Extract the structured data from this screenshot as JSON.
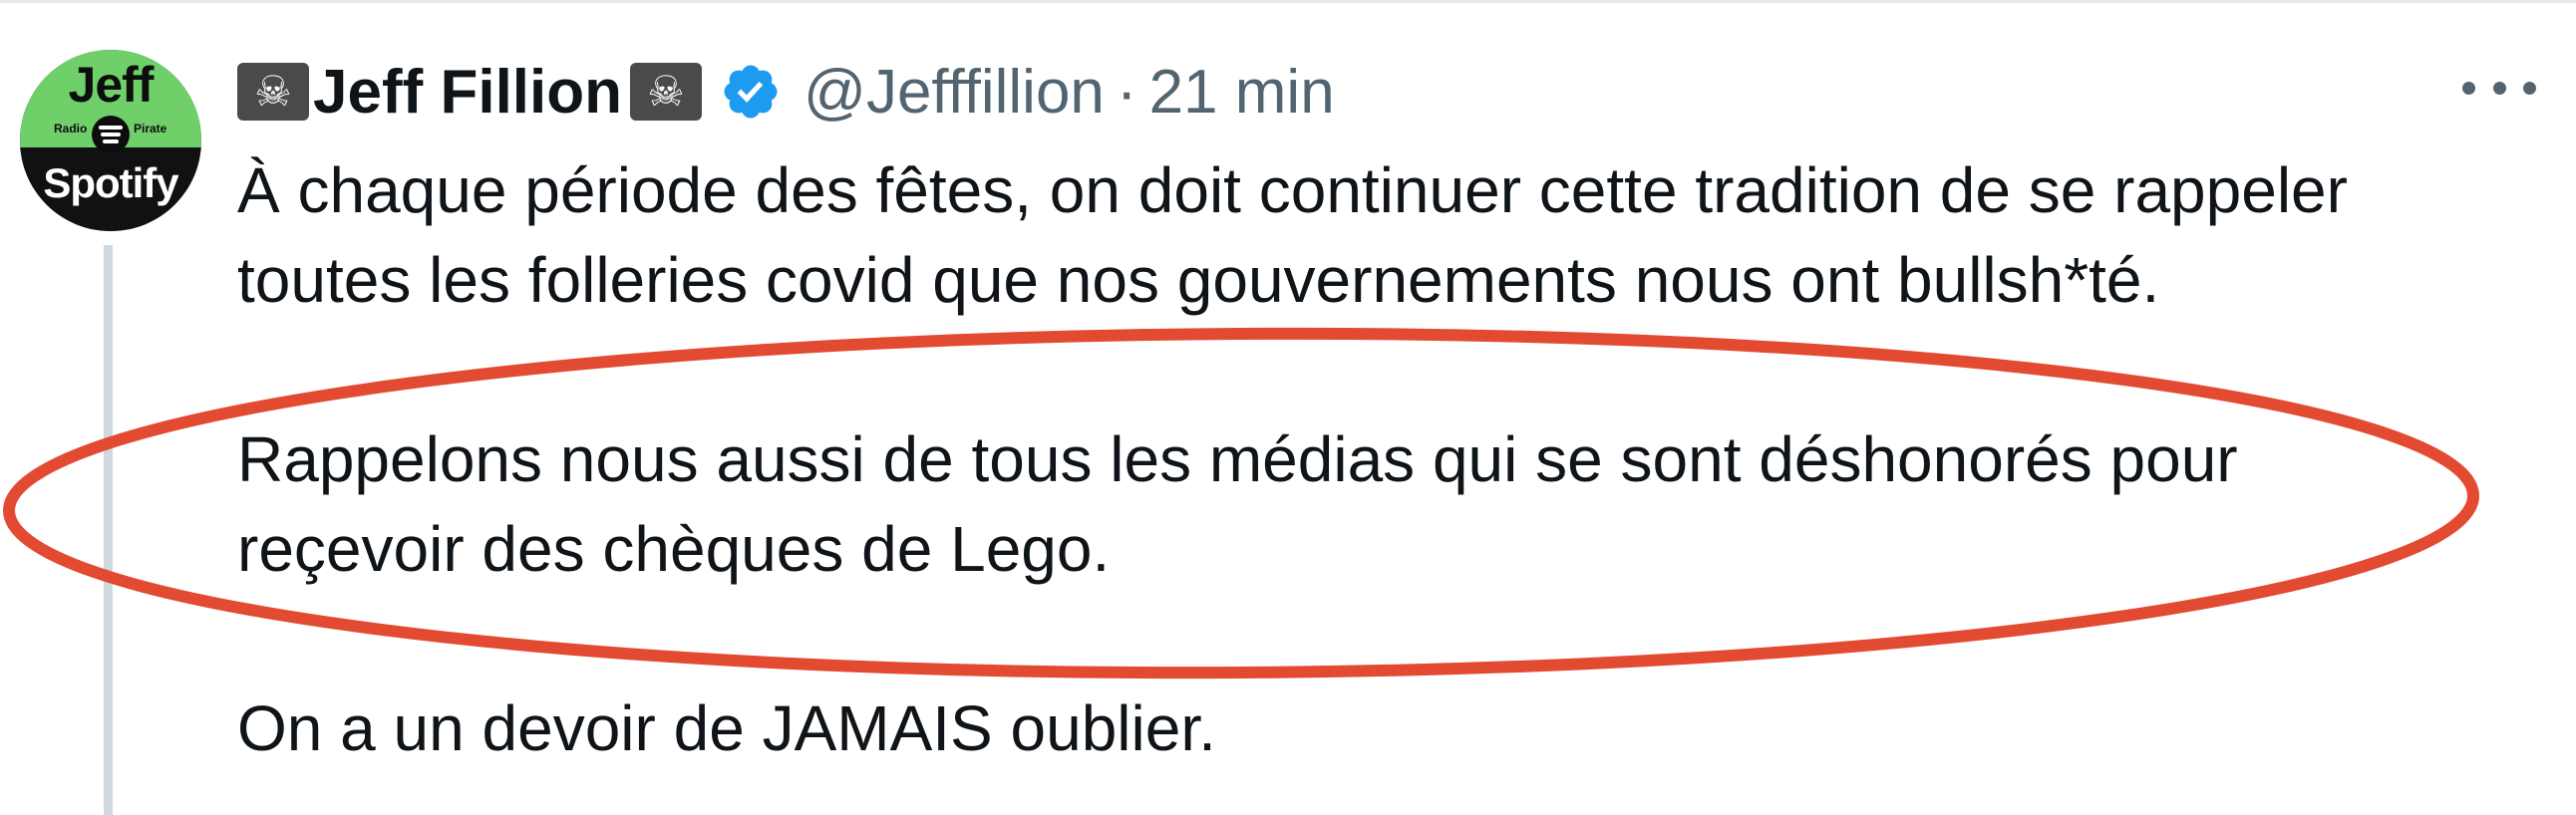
{
  "tweet": {
    "author": {
      "display_name": "Jeff Fillion",
      "handle": "@Jefffillion",
      "verified": true,
      "name_emoji": "☠"
    },
    "separator": "·",
    "time": "21 min",
    "avatar": {
      "top_text": "Jeff",
      "small_left": "Radio",
      "small_right": "Pirate",
      "bottom_text": "Spotify"
    },
    "text_lines": [
      "À chaque période des fêtes, on doit continuer cette tradition de se rappeler",
      "toutes les folleries covid que nos gouvernements nous ont bullsh*té.",
      "Rappelons nous aussi de tous les médias qui se sont déshonorés pour",
      "reçevoir des chèques de Lego.",
      "On a un devoir de JAMAIS oublier."
    ]
  },
  "colors": {
    "text": "#0f1419",
    "secondary_text": "#536471",
    "verified_badge": "#1d9bf0",
    "annotation_ellipse": "#e34a32",
    "thread_line": "#cfd9de",
    "avatar_green": "#6fd06a"
  },
  "icons": {
    "verified": "verified-badge-icon",
    "more": "more-options-icon",
    "emoji": "skull-and-crossbones-emoji"
  }
}
